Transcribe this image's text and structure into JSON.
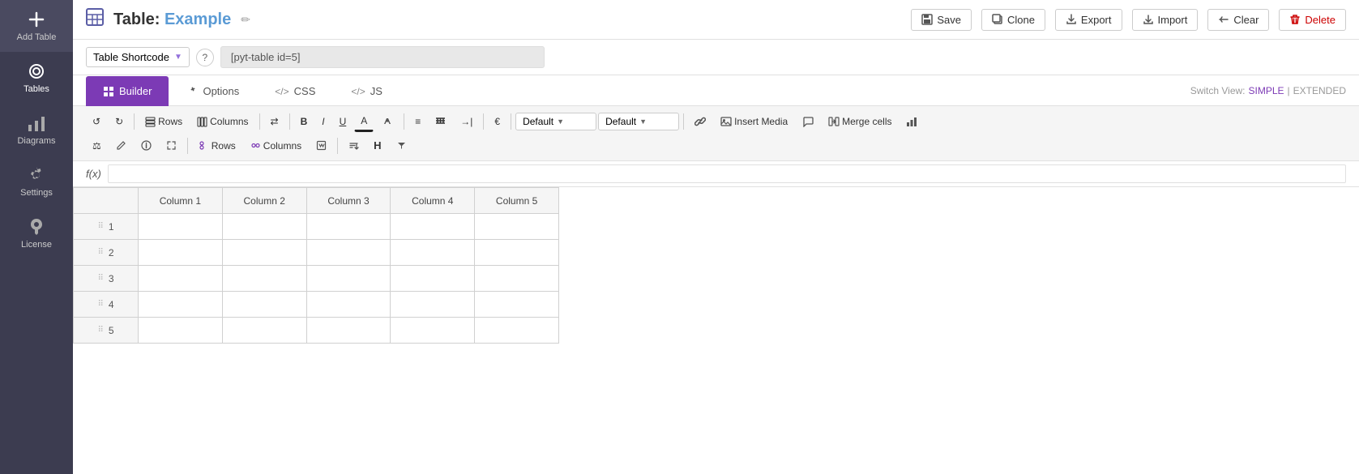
{
  "sidebar": {
    "add_label": "Add Table",
    "tables_label": "Tables",
    "diagrams_label": "Diagrams",
    "settings_label": "Settings",
    "license_label": "License"
  },
  "header": {
    "title_prefix": "Table:",
    "table_name": "Example",
    "edit_icon": "✏"
  },
  "toolbar": {
    "shortcode_dropdown_label": "Table Shortcode",
    "help_label": "?",
    "shortcode_value": "[pyt-table id=5]",
    "save_label": "Save",
    "clone_label": "Clone",
    "export_label": "Export",
    "import_label": "Import",
    "clear_label": "Clear",
    "delete_label": "Delete"
  },
  "tabs": {
    "builder_label": "Builder",
    "options_label": "Options",
    "css_label": "CSS",
    "js_label": "JS",
    "switch_view_label": "Switch View:",
    "simple_label": "SIMPLE",
    "extended_label": "EXTENDED"
  },
  "builder": {
    "rows_label": "Rows",
    "columns_label": "Columns",
    "bold_label": "B",
    "italic_label": "I",
    "underline_label": "U",
    "strikethrough_label": "A",
    "color_label": "A",
    "align_left_label": "≡",
    "align_center_label": "|||",
    "align_right_label": "→|",
    "currency_label": "€",
    "default_font_label": "Default",
    "default_size_label": "Default",
    "insert_media_label": "Insert Media",
    "merge_cells_label": "Merge cells",
    "formula_label": "f(x)",
    "rows2_label": "Rows",
    "columns2_label": "Columns"
  },
  "table": {
    "columns": [
      "Column 1",
      "Column 2",
      "Column 3",
      "Column 4",
      "Column 5"
    ],
    "rows": [
      {
        "num": 1,
        "cells": [
          "",
          "",
          "",
          "",
          ""
        ]
      },
      {
        "num": 2,
        "cells": [
          "",
          "",
          "",
          "",
          ""
        ]
      },
      {
        "num": 3,
        "cells": [
          "",
          "",
          "",
          "",
          ""
        ]
      },
      {
        "num": 4,
        "cells": [
          "",
          "",
          "",
          "",
          ""
        ]
      },
      {
        "num": 5,
        "cells": [
          "",
          "",
          "",
          "",
          ""
        ]
      }
    ]
  }
}
